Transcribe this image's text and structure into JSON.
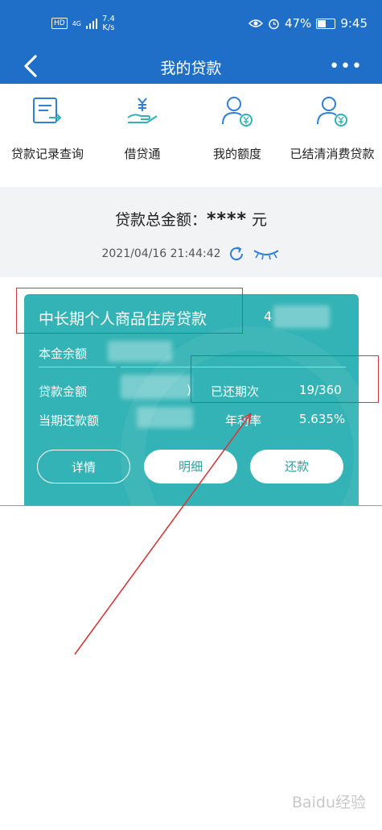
{
  "status_bar": {
    "hd": "HD",
    "network": "4G",
    "speed": "7.4",
    "speed_unit": "K/s",
    "battery": "47%",
    "time": "9:45"
  },
  "nav": {
    "title": "我的贷款",
    "back_icon": "chevron-left-icon",
    "more_icon": "ellipsis-icon"
  },
  "shortcuts": [
    {
      "label": "贷款记录查询",
      "icon": "document-arrow-icon"
    },
    {
      "label": "借贷通",
      "icon": "hand-yuan-icon"
    },
    {
      "label": "我的额度",
      "icon": "person-yuan-icon"
    },
    {
      "label": "已结清消费贷款",
      "icon": "person-yuan-icon"
    }
  ],
  "summary": {
    "label": "贷款总金额：",
    "amount": "****",
    "unit": "元",
    "timestamp": "2021/04/16 21:44:42"
  },
  "loan_card": {
    "title": "中长期个人商品住房贷款",
    "account_prefix": "4",
    "principal_label": "本金余额",
    "loan_amount_label": "贷款金额",
    "loan_amount_tail": ")",
    "periods_label": "已还期次",
    "periods_value": "19/360",
    "current_payment_label": "当期还款额",
    "rate_label": "年利率",
    "rate_value": "5.635%",
    "buttons": {
      "details": "详情",
      "statement": "明细",
      "repay": "还款"
    }
  },
  "colors": {
    "header_blue": "#1f6fc9",
    "card_teal": "#33b3b5",
    "annotation_red": "#d43a3a"
  },
  "watermark": "Baidu经验"
}
